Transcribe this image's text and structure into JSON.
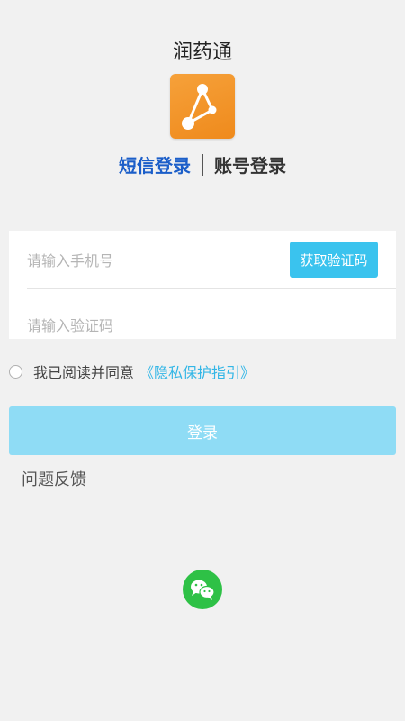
{
  "app": {
    "title": "润药通",
    "logo_icon": "network-graph-icon",
    "logo_color": "#f39a2a"
  },
  "tabs": {
    "sms_label": "短信登录",
    "account_label": "账号登录",
    "active": "sms"
  },
  "form": {
    "phone_placeholder": "请输入手机号",
    "phone_value": "",
    "code_placeholder": "请输入验证码",
    "code_value": "",
    "get_code_label": "获取验证码"
  },
  "agreement": {
    "checked": false,
    "text": "我已阅读并同意",
    "link_text": "《隐私保护指引》"
  },
  "actions": {
    "login_label": "登录",
    "feedback_label": "问题反馈"
  },
  "social": {
    "wechat_icon": "wechat-icon"
  },
  "colors": {
    "accent": "#1b5ec9",
    "button": "#3ac3ee",
    "login_button_disabled": "#8fdcf5",
    "wechat": "#2ec146"
  }
}
